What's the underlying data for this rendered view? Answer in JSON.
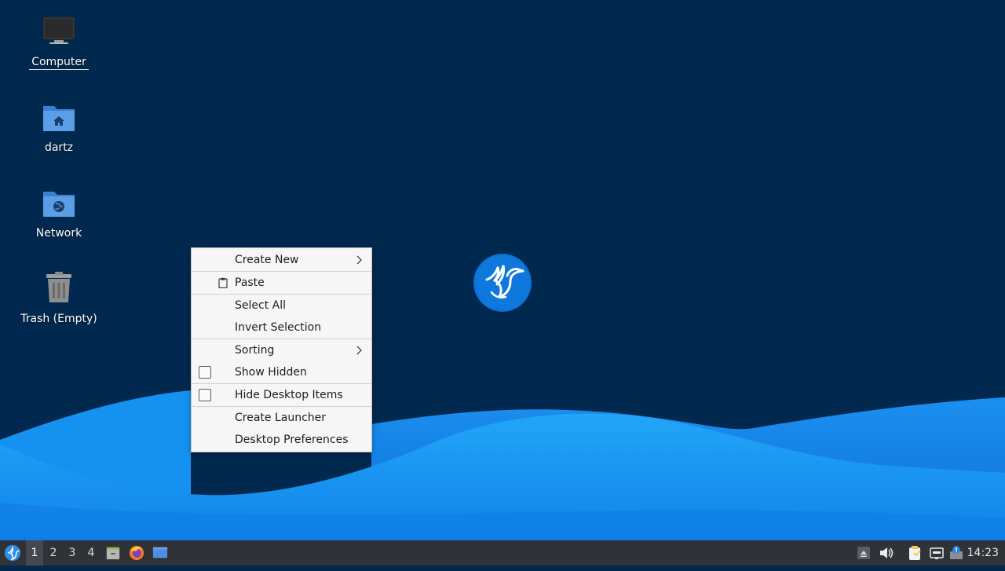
{
  "desktop": {
    "icons": [
      {
        "label": "Computer",
        "icon": "computer-icon"
      },
      {
        "label": "dartz",
        "icon": "home-folder-icon"
      },
      {
        "label": "Network",
        "icon": "network-folder-icon"
      },
      {
        "label": "Trash (Empty)",
        "icon": "trash-icon"
      }
    ],
    "center_logo": "hummingbird-logo-icon"
  },
  "context_menu": {
    "items": [
      {
        "label": "Create New",
        "submenu": true
      },
      {
        "label": "Paste",
        "icon": "clipboard-icon"
      },
      {
        "label": "Select All"
      },
      {
        "label": "Invert Selection"
      },
      {
        "label": "Sorting",
        "submenu": true
      },
      {
        "label": "Show Hidden",
        "checkbox": false
      },
      {
        "label": "Hide Desktop Items",
        "checkbox": false
      },
      {
        "label": "Create Launcher"
      },
      {
        "label": "Desktop Preferences"
      }
    ]
  },
  "taskbar": {
    "menu_icon": "start-menu-icon",
    "workspaces": [
      "1",
      "2",
      "3",
      "4"
    ],
    "active_workspace": "1",
    "launchers": [
      "file-manager-icon",
      "firefox-icon",
      "show-desktop-icon"
    ],
    "tray": [
      "tray-expand-icon",
      "volume-icon",
      "clipboard-manager-icon",
      "network-icon",
      "update-notifier-icon"
    ],
    "clock": "14:23"
  },
  "colors": {
    "background": "#01284f",
    "wave_light": "#1e9df5",
    "wave_mid": "#0b7ee6",
    "taskbar": "#2f3237",
    "menu_bg": "#f6f6f6"
  }
}
